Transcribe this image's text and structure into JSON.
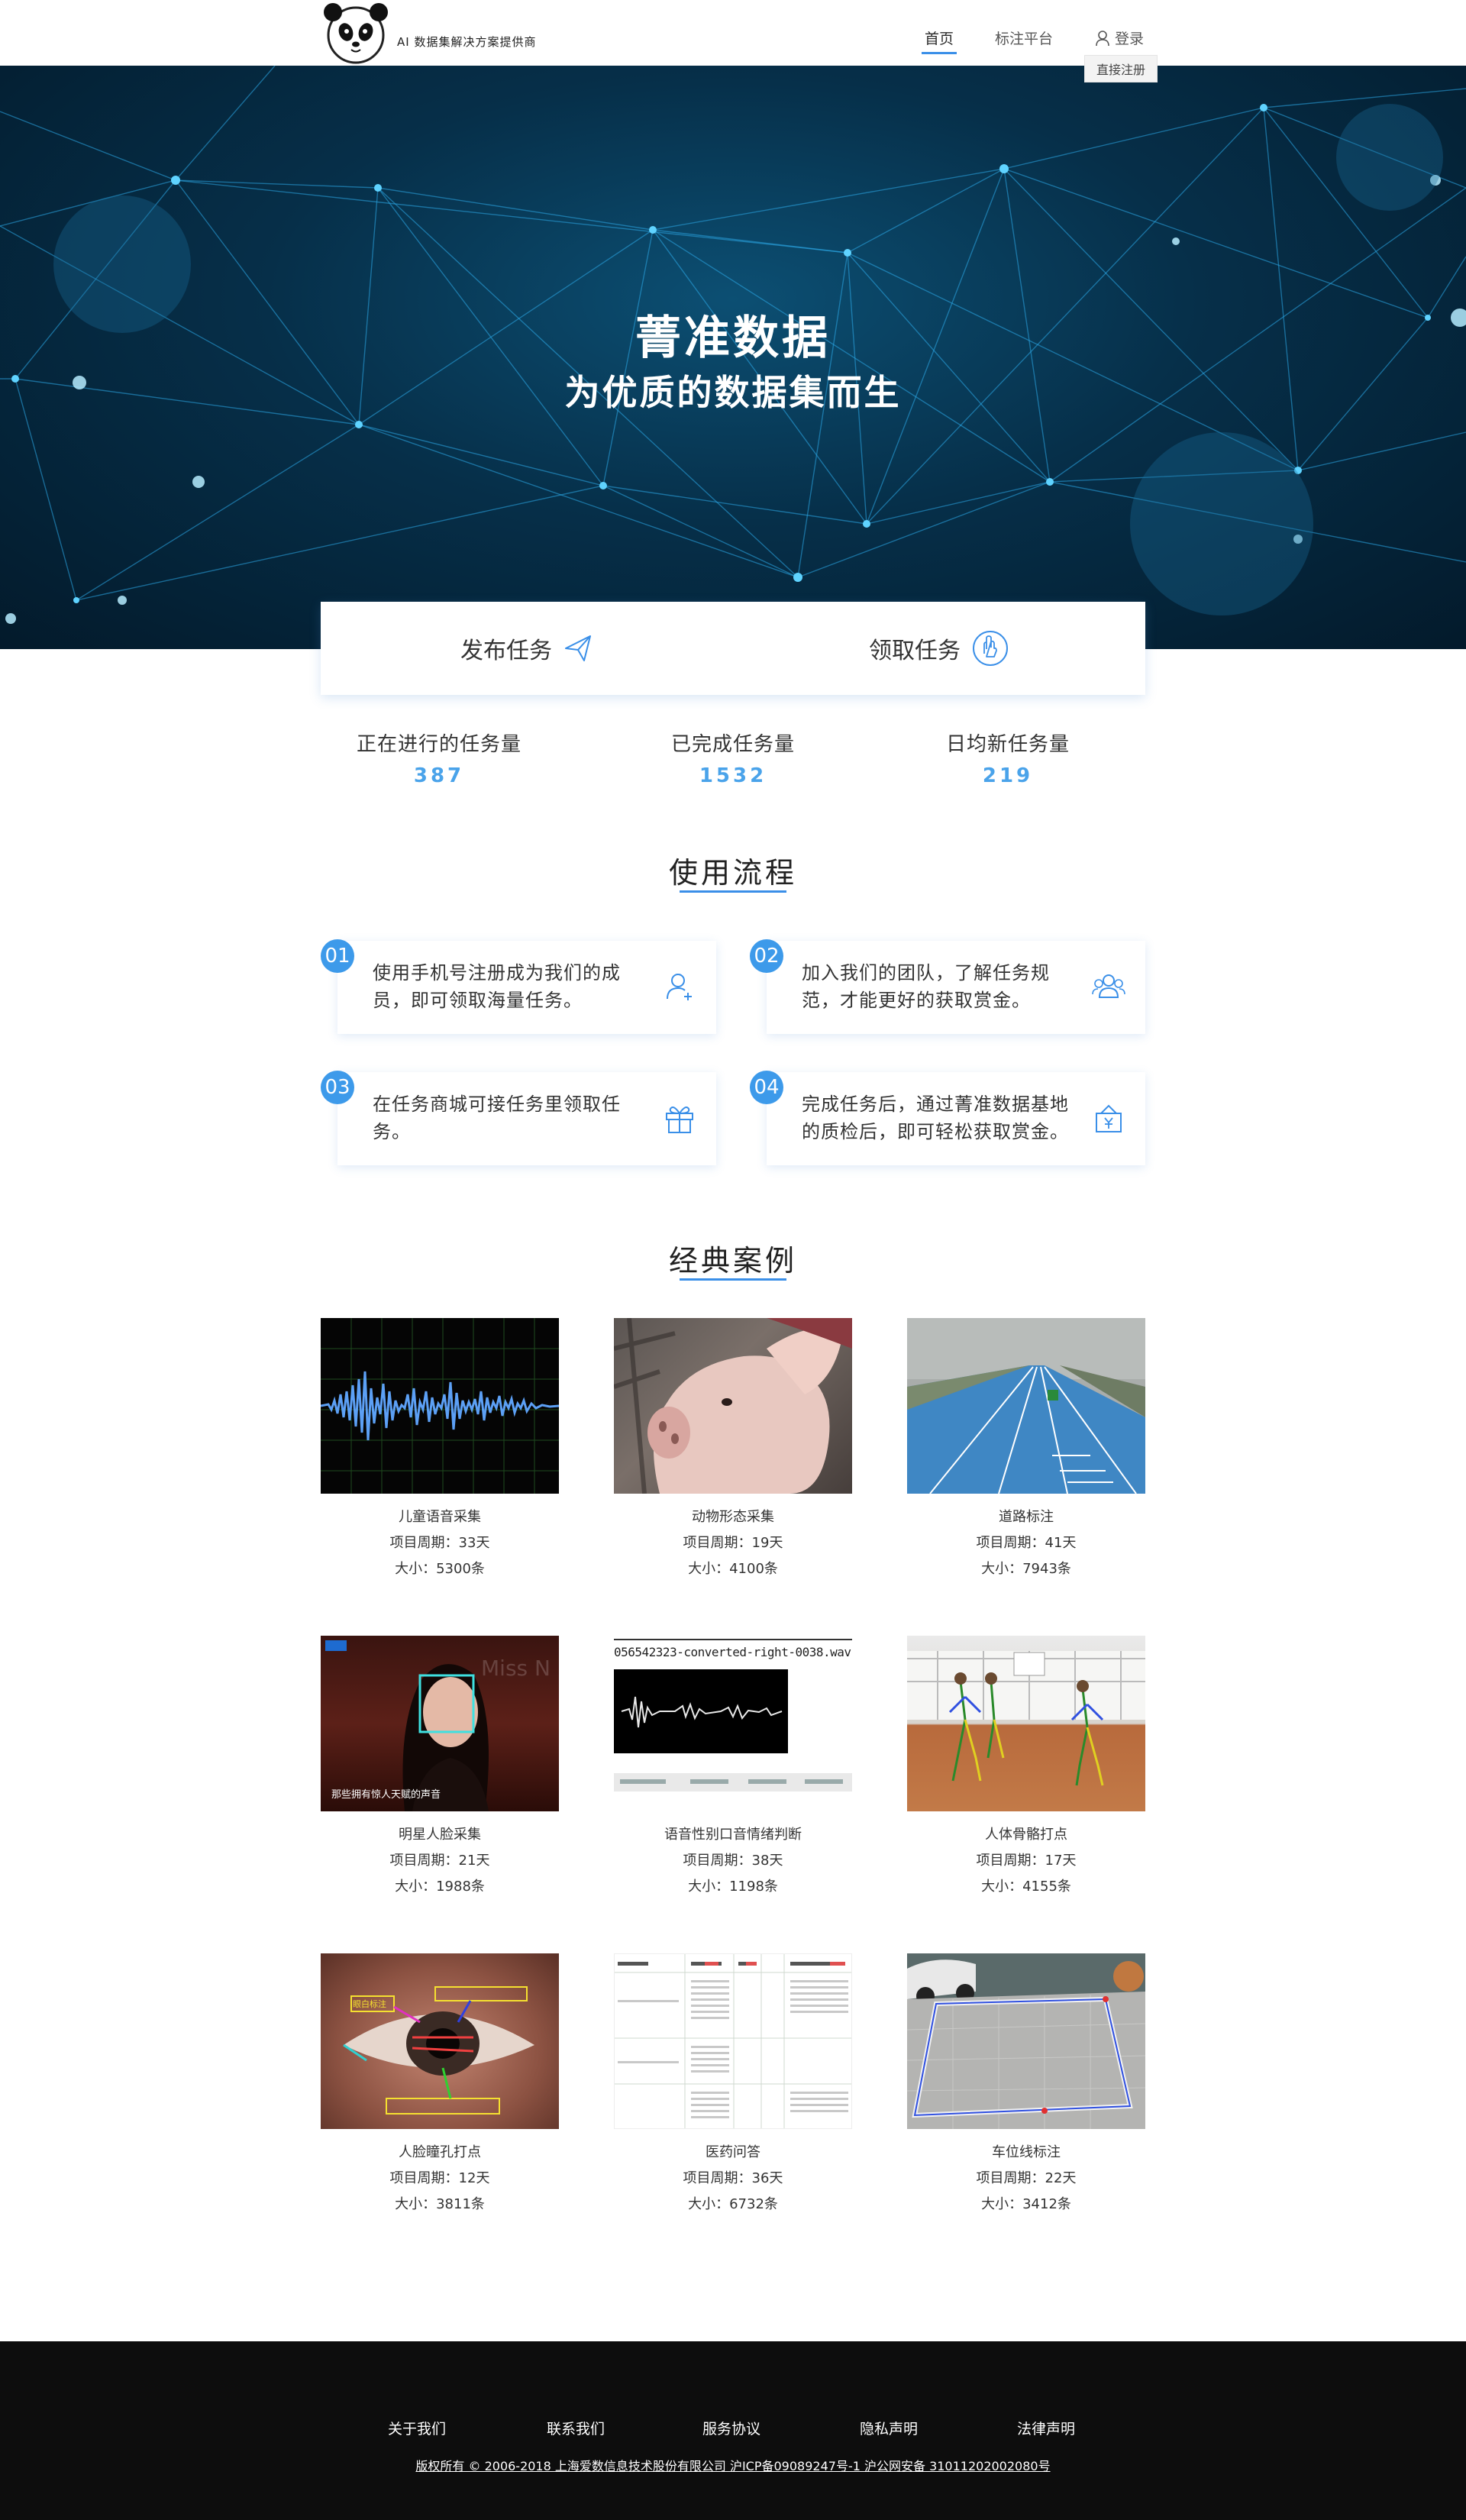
{
  "header": {
    "tagline": "AI 数据集解决方案提供商",
    "nav": {
      "home": "首页",
      "platform": "标注平台",
      "login": "登录",
      "register": "直接注册"
    }
  },
  "hero": {
    "title": "菁准数据",
    "subtitle": "为优质的数据集而生"
  },
  "task_card": {
    "publish": "发布任务",
    "receive": "领取任务"
  },
  "stats": [
    {
      "label": "正在进行的任务量",
      "value": "387"
    },
    {
      "label": "已完成任务量",
      "value": "1532"
    },
    {
      "label": "日均新任务量",
      "value": "219"
    }
  ],
  "process": {
    "title": "使用流程",
    "steps": [
      {
        "num": "01",
        "text": "使用手机号注册成为我们的成员，即可领取海量任务。",
        "icon": "add-user-icon"
      },
      {
        "num": "02",
        "text": "加入我们的团队，了解任务规范，才能更好的获取赏金。",
        "icon": "team-icon"
      },
      {
        "num": "03",
        "text": "在任务商城可接任务里领取任务。",
        "icon": "gift-icon"
      },
      {
        "num": "04",
        "text": "完成任务后，通过菁准数据基地的质检后，即可轻松获取赏金。",
        "icon": "money-bag-icon"
      }
    ]
  },
  "cases": {
    "title": "经典案例",
    "items": [
      {
        "name": "儿童语音采集",
        "period": "项目周期：33天",
        "size": "大小：5300条"
      },
      {
        "name": "动物形态采集",
        "period": "项目周期：19天",
        "size": "大小：4100条"
      },
      {
        "name": "道路标注",
        "period": "项目周期：41天",
        "size": "大小：7943条"
      },
      {
        "name": "明星人脸采集",
        "period": "项目周期：21天",
        "size": "大小：1988条"
      },
      {
        "name": "语音性别口音情绪判断",
        "period": "项目周期：38天",
        "size": "大小：1198条"
      },
      {
        "name": "人体骨骼打点",
        "period": "项目周期：17天",
        "size": "大小：4155条"
      },
      {
        "name": "人脸瞳孔打点",
        "period": "项目周期：12天",
        "size": "大小：3811条"
      },
      {
        "name": "医药问答",
        "period": "项目周期：36天",
        "size": "大小：6732条"
      },
      {
        "name": "车位线标注",
        "period": "项目周期：22天",
        "size": "大小：3412条"
      }
    ],
    "thumb_text": {
      "face_caption": "那些拥有惊人天赋的声音",
      "audio_filename": "056542323-converted-right-0038.wav",
      "eye_label": "眼白标注"
    }
  },
  "footer": {
    "links": [
      "关于我们",
      "联系我们",
      "服务协议",
      "隐私声明",
      "法律声明"
    ],
    "copyright": "版权所有 © 2006-2018 上海爱数信息技术股份有限公司 沪ICP备09089247号-1 沪公网安备 31011202002080号"
  },
  "colors": {
    "accent": "#3a8fe8",
    "stat": "#4aa3ea",
    "hero_dark": "#031a2b",
    "footer": "#0d0d0d"
  }
}
